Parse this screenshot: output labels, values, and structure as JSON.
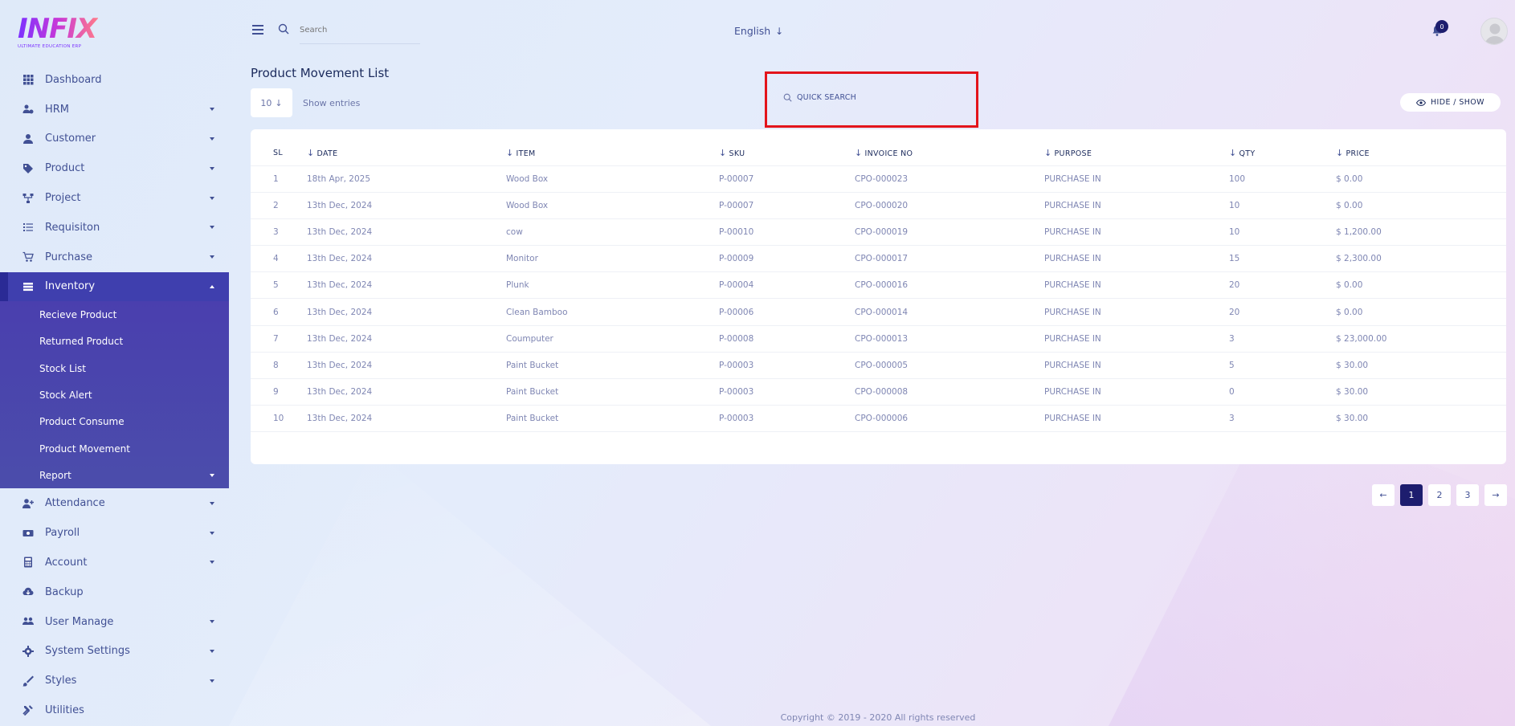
{
  "logo": {
    "text": "INFIX",
    "subtitle": "ULTIMATE EDUCATION ERP"
  },
  "header": {
    "search_placeholder": "Search",
    "language": "English",
    "notification_count": "0"
  },
  "sidebar": {
    "items_top": [
      {
        "label": "Dashboard",
        "icon": "grid-icon",
        "has_caret": false
      },
      {
        "label": "HRM",
        "icon": "users-cog-icon",
        "has_caret": true
      },
      {
        "label": "Customer",
        "icon": "user-icon",
        "has_caret": true
      },
      {
        "label": "Product",
        "icon": "tags-icon",
        "has_caret": true
      },
      {
        "label": "Project",
        "icon": "project-diagram-icon",
        "has_caret": true
      },
      {
        "label": "Requisiton",
        "icon": "list-icon",
        "has_caret": true
      },
      {
        "label": "Purchase",
        "icon": "cart-icon",
        "has_caret": true
      }
    ],
    "active_item": {
      "label": "Inventory",
      "icon": "inventory-icon"
    },
    "sub_items": [
      {
        "label": "Recieve Product"
      },
      {
        "label": "Returned Product"
      },
      {
        "label": "Stock List"
      },
      {
        "label": "Stock Alert"
      },
      {
        "label": "Product Consume"
      },
      {
        "label": "Product Movement"
      },
      {
        "label": "Report"
      }
    ],
    "items_bottom": [
      {
        "label": "Attendance",
        "icon": "user-plus-icon",
        "has_caret": true
      },
      {
        "label": "Payroll",
        "icon": "money-icon",
        "has_caret": true
      },
      {
        "label": "Account",
        "icon": "calculator-icon",
        "has_caret": true
      },
      {
        "label": "Backup",
        "icon": "cloud-download-icon",
        "has_caret": false
      },
      {
        "label": "User Manage",
        "icon": "users-icon",
        "has_caret": true
      },
      {
        "label": "System Settings",
        "icon": "gear-icon",
        "has_caret": true
      },
      {
        "label": "Styles",
        "icon": "brush-icon",
        "has_caret": true
      },
      {
        "label": "Utilities",
        "icon": "tools-icon",
        "has_caret": false
      }
    ]
  },
  "main": {
    "title": "Product Movement List",
    "entries_value": "10",
    "entries_label": "Show entries",
    "quick_search_placeholder": "QUICK SEARCH",
    "hide_show_label": "HIDE / SHOW",
    "table": {
      "headers": [
        "SL",
        "DATE",
        "ITEM",
        "SKU",
        "INVOICE NO",
        "PURPOSE",
        "QTY",
        "PRICE"
      ],
      "rows": [
        [
          "1",
          "18th Apr, 2025",
          "Wood Box",
          "P-00007",
          "CPO-000023",
          "PURCHASE IN",
          "100",
          "$ 0.00"
        ],
        [
          "2",
          "13th Dec, 2024",
          "Wood Box",
          "P-00007",
          "CPO-000020",
          "PURCHASE IN",
          "10",
          "$ 0.00"
        ],
        [
          "3",
          "13th Dec, 2024",
          "cow",
          "P-00010",
          "CPO-000019",
          "PURCHASE IN",
          "10",
          "$ 1,200.00"
        ],
        [
          "4",
          "13th Dec, 2024",
          "Monitor",
          "P-00009",
          "CPO-000017",
          "PURCHASE IN",
          "15",
          "$ 2,300.00"
        ],
        [
          "5",
          "13th Dec, 2024",
          "Plunk",
          "P-00004",
          "CPO-000016",
          "PURCHASE IN",
          "20",
          "$ 0.00"
        ],
        [
          "6",
          "13th Dec, 2024",
          "Clean Bamboo",
          "P-00006",
          "CPO-000014",
          "PURCHASE IN",
          "20",
          "$ 0.00"
        ],
        [
          "7",
          "13th Dec, 2024",
          "Coumputer",
          "P-00008",
          "CPO-000013",
          "PURCHASE IN",
          "3",
          "$ 23,000.00"
        ],
        [
          "8",
          "13th Dec, 2024",
          "Paint Bucket",
          "P-00003",
          "CPO-000005",
          "PURCHASE IN",
          "5",
          "$ 30.00"
        ],
        [
          "9",
          "13th Dec, 2024",
          "Paint Bucket",
          "P-00003",
          "CPO-000008",
          "PURCHASE IN",
          "0",
          "$ 30.00"
        ],
        [
          "10",
          "13th Dec, 2024",
          "Paint Bucket",
          "P-00003",
          "CPO-000006",
          "PURCHASE IN",
          "3",
          "$ 30.00"
        ]
      ]
    },
    "pagination": {
      "prev": "←",
      "pages": [
        "1",
        "2",
        "3"
      ],
      "active_page": "1",
      "next": "→"
    }
  },
  "footer": {
    "text": "Copyright © 2019 - 2020 All rights reserved"
  },
  "colors": {
    "accent": "#415094",
    "active_menu": "#3f3fae",
    "highlight_border": "#e3141b",
    "badge": "#1d1d6e"
  }
}
